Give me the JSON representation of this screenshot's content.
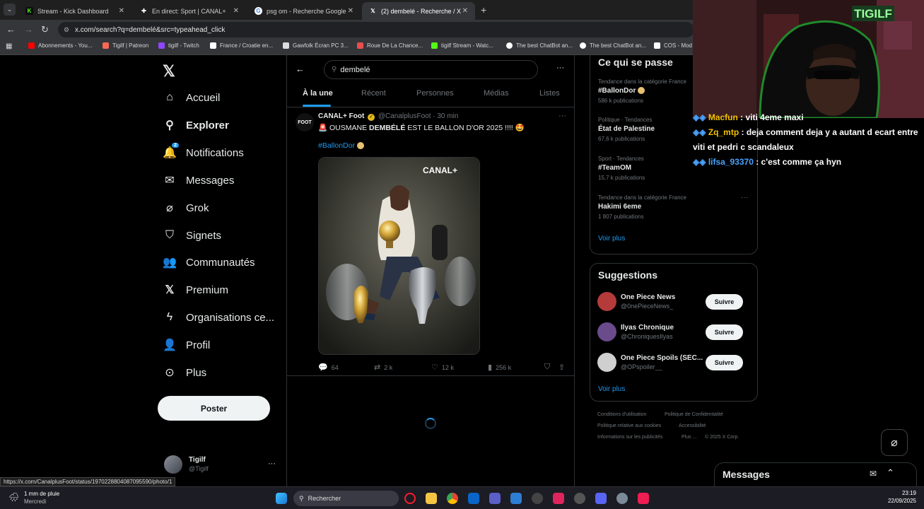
{
  "browser": {
    "tabs": [
      {
        "title": "Stream - Kick Dashboard",
        "icon": "kick-icon",
        "color": "#53fc18"
      },
      {
        "title": "En direct: Sport | CANAL+",
        "icon": "canal-icon",
        "color": "#ffffff"
      },
      {
        "title": "psg om - Recherche Google",
        "icon": "google-icon",
        "color": "#4285f4"
      },
      {
        "title": "(2) dembelé - Recherche / X",
        "icon": "x-icon",
        "color": "#ffffff"
      }
    ],
    "url": "x.com/search?q=dembelé&src=typeahead_click",
    "bookmarks": [
      "Abonnements - You...",
      "Tigilf | Patreon",
      "tigilf - Twitch",
      "France / Croatie en...",
      "Gawfolk Écran PC 3...",
      "Roue De La Chance...",
      "tigilf Stream - Watc...",
      "The best ChatBot an...",
      "The best ChatBot an...",
      "COS - Mod"
    ]
  },
  "sidebar": {
    "items": [
      {
        "label": "Accueil",
        "icon": "home-icon"
      },
      {
        "label": "Explorer",
        "icon": "search-icon"
      },
      {
        "label": "Notifications",
        "icon": "bell-icon",
        "badge": "2"
      },
      {
        "label": "Messages",
        "icon": "mail-icon"
      },
      {
        "label": "Grok",
        "icon": "grok-icon"
      },
      {
        "label": "Signets",
        "icon": "bookmark-icon"
      },
      {
        "label": "Communautés",
        "icon": "people-icon"
      },
      {
        "label": "Premium",
        "icon": "x-logo-icon"
      },
      {
        "label": "Organisations ce...",
        "icon": "lightning-icon"
      },
      {
        "label": "Profil",
        "icon": "person-icon"
      },
      {
        "label": "Plus",
        "icon": "more-circle-icon"
      }
    ],
    "post_label": "Poster",
    "account": {
      "name": "Tigilf",
      "handle": "@Tigilf",
      "more": "···"
    }
  },
  "search": {
    "query": "dembelé",
    "tabs": [
      "À la une",
      "Récent",
      "Personnes",
      "Médias",
      "Listes"
    ],
    "more": "···"
  },
  "tweet": {
    "author": "CANAL+ Foot",
    "avatar_text": "FOOT",
    "handle": "@CanalplusFoot",
    "time": "· 30 min",
    "text_prefix": "🚨 OUSMANE ",
    "text_bold": "DEMBÉLÉ",
    "text_suffix": " EST LE BALLON D'OR 2025 !!!! 🤩",
    "hashtag": "#BallonDor",
    "media_watermark": "CANAL+",
    "replies": "64",
    "reposts": "2 k",
    "likes": "12 k",
    "views": "256 k",
    "more": "···"
  },
  "trends": {
    "title": "Ce qui se passe",
    "items": [
      {
        "meta": "Tendance dans la catégorie France",
        "name": "#BallonDor",
        "count": "586 k publications"
      },
      {
        "meta": "Politique · Tendances",
        "name": "État de Palestine",
        "count": "67,6 k publications"
      },
      {
        "meta": "Sport · Tendances",
        "name": "#TeamOM",
        "count": "15,7 k publications"
      },
      {
        "meta": "Tendance dans la catégorie France",
        "name": "Hakimi 6eme",
        "count": "1 807 publications"
      }
    ],
    "more": "Voir plus"
  },
  "suggestions": {
    "title": "Suggestions",
    "items": [
      {
        "name": "One Piece News",
        "handle": "@0nePieceNews_",
        "button": "Suivre",
        "color": "#b53a3a"
      },
      {
        "name": "Ilyas Chronique",
        "handle": "@ChroniquesIlyas",
        "button": "Suivre",
        "color": "#6a4b8c"
      },
      {
        "name": "One Piece Spoils (SEC...",
        "handle": "@OPspoiler__",
        "button": "Suivre",
        "color": "#cfcfcf"
      }
    ],
    "more": "Voir plus"
  },
  "footer": {
    "links": [
      "Conditions d'utilisation",
      "Politique de Confidentialité",
      "Politique relative aux cookies",
      "Accessibilité",
      "Informations sur les publicités",
      "Plus ...",
      "© 2025 X Corp."
    ]
  },
  "stream": {
    "cam_label": "TIGILF",
    "chat": [
      {
        "user": "Macfun",
        "text": " : viti 4eme maxi",
        "color": "#f3c200"
      },
      {
        "user": "Zq_mtp",
        "text": " : deja comment deja y a autant d ecart entre viti et pedri c scandaleux",
        "color": "#f3c200"
      },
      {
        "user": "lifsa_93370",
        "text": " : c'est comme ça hyn",
        "color": "#4aa3ff"
      }
    ]
  },
  "messages_dock": {
    "title": "Messages"
  },
  "status_url": "https://x.com/CanalplusFoot/status/1970228804087095590/photo/1",
  "taskbar": {
    "weather": "1 mm de pluie",
    "weather_day": "Mercredi",
    "search_placeholder": "Rechercher",
    "time": "23:19",
    "date": "22/09/2025"
  }
}
